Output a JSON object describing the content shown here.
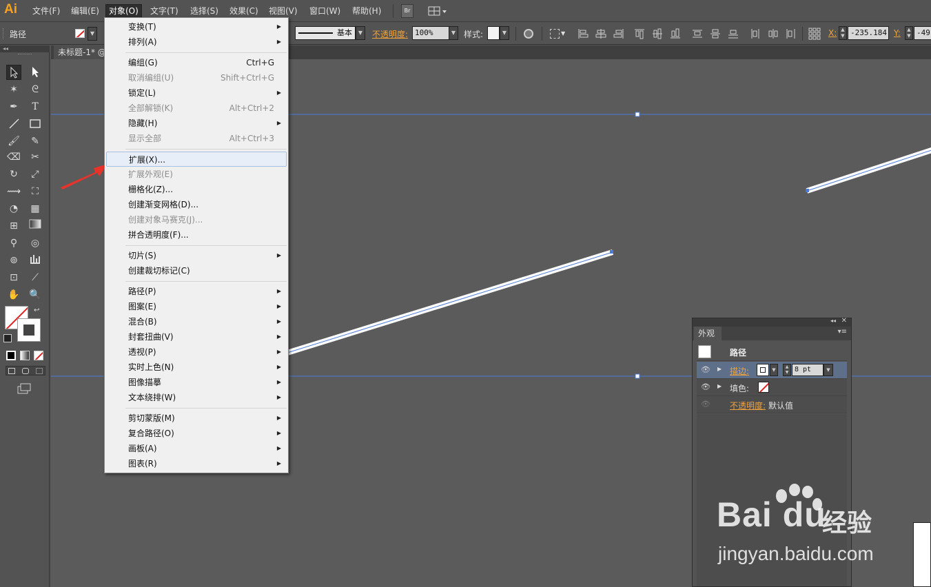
{
  "app": {
    "logo": "Ai"
  },
  "menubar": {
    "items": [
      "文件(F)",
      "编辑(E)",
      "对象(O)",
      "文字(T)",
      "选择(S)",
      "效果(C)",
      "视图(V)",
      "窗口(W)",
      "帮助(H)"
    ],
    "active_index": 2,
    "bridge_label": "Br"
  },
  "controlbar": {
    "selection_type": "路径",
    "stroke_style": "基本",
    "opacity_label": "不透明度:",
    "opacity_value": "100%",
    "style_label": "样式:",
    "x_label": "X:",
    "x_value": "-235.184",
    "y_label": "Y:",
    "y_value": "-49"
  },
  "document": {
    "tab_title": "未标题-1* @"
  },
  "object_menu": {
    "items": [
      {
        "label": "变换(T)",
        "shortcut": "",
        "submenu": true,
        "disabled": false
      },
      {
        "label": "排列(A)",
        "shortcut": "",
        "submenu": true,
        "disabled": false
      },
      {
        "label": "编组(G)",
        "shortcut": "Ctrl+G",
        "submenu": false,
        "disabled": false
      },
      {
        "label": "取消编组(U)",
        "shortcut": "Shift+Ctrl+G",
        "submenu": false,
        "disabled": true
      },
      {
        "label": "锁定(L)",
        "shortcut": "",
        "submenu": true,
        "disabled": false
      },
      {
        "label": "全部解锁(K)",
        "shortcut": "Alt+Ctrl+2",
        "submenu": false,
        "disabled": true
      },
      {
        "label": "隐藏(H)",
        "shortcut": "",
        "submenu": true,
        "disabled": false
      },
      {
        "label": "显示全部",
        "shortcut": "Alt+Ctrl+3",
        "submenu": false,
        "disabled": true
      },
      {
        "label": "扩展(X)...",
        "shortcut": "",
        "submenu": false,
        "disabled": false,
        "highlighted": true
      },
      {
        "label": "扩展外观(E)",
        "shortcut": "",
        "submenu": false,
        "disabled": true
      },
      {
        "label": "栅格化(Z)...",
        "shortcut": "",
        "submenu": false,
        "disabled": false
      },
      {
        "label": "创建渐变网格(D)...",
        "shortcut": "",
        "submenu": false,
        "disabled": false
      },
      {
        "label": "创建对象马赛克(J)...",
        "shortcut": "",
        "submenu": false,
        "disabled": true
      },
      {
        "label": "拼合透明度(F)...",
        "shortcut": "",
        "submenu": false,
        "disabled": false
      },
      {
        "label": "切片(S)",
        "shortcut": "",
        "submenu": true,
        "disabled": false
      },
      {
        "label": "创建裁切标记(C)",
        "shortcut": "",
        "submenu": false,
        "disabled": false
      },
      {
        "label": "路径(P)",
        "shortcut": "",
        "submenu": true,
        "disabled": false
      },
      {
        "label": "图案(E)",
        "shortcut": "",
        "submenu": true,
        "disabled": false
      },
      {
        "label": "混合(B)",
        "shortcut": "",
        "submenu": true,
        "disabled": false
      },
      {
        "label": "封套扭曲(V)",
        "shortcut": "",
        "submenu": true,
        "disabled": false
      },
      {
        "label": "透视(P)",
        "shortcut": "",
        "submenu": true,
        "disabled": false
      },
      {
        "label": "实时上色(N)",
        "shortcut": "",
        "submenu": true,
        "disabled": false
      },
      {
        "label": "图像描摹",
        "shortcut": "",
        "submenu": true,
        "disabled": false
      },
      {
        "label": "文本绕排(W)",
        "shortcut": "",
        "submenu": true,
        "disabled": false
      },
      {
        "label": "剪切蒙版(M)",
        "shortcut": "",
        "submenu": true,
        "disabled": false
      },
      {
        "label": "复合路径(O)",
        "shortcut": "",
        "submenu": true,
        "disabled": false
      },
      {
        "label": "画板(A)",
        "shortcut": "",
        "submenu": true,
        "disabled": false
      },
      {
        "label": "图表(R)",
        "shortcut": "",
        "submenu": true,
        "disabled": false
      }
    ]
  },
  "appearance_panel": {
    "tab": "外观",
    "title": "路径",
    "stroke_label": "描边:",
    "stroke_weight": "8 pt",
    "fill_label": "填色:",
    "opacity_label": "不透明度:",
    "opacity_value": "默认值"
  },
  "watermark": {
    "brand": "Bai du",
    "cn": "经验",
    "url": "jingyan.baidu.com"
  },
  "colors": {
    "accent_orange": "#f7a21c",
    "guide_blue": "#4a7bd8",
    "arrow_red": "#e8332b"
  }
}
